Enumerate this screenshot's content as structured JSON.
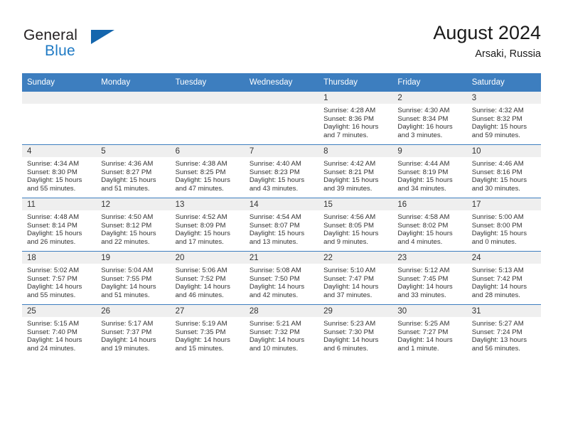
{
  "brand": {
    "name_part1": "General",
    "name_part2": "Blue",
    "logo_icon": "triangle-icon"
  },
  "header": {
    "title": "August 2024",
    "location": "Arsaki, Russia"
  },
  "calendar": {
    "weekday_headers": [
      "Sunday",
      "Monday",
      "Tuesday",
      "Wednesday",
      "Thursday",
      "Friday",
      "Saturday"
    ],
    "labels": {
      "sunrise": "Sunrise:",
      "sunset": "Sunset:",
      "daylight": "Daylight:"
    },
    "accent_color": "#3d7ebf",
    "daynum_bg": "#efefef",
    "weeks": [
      [
        {
          "day": "",
          "empty": true
        },
        {
          "day": "",
          "empty": true
        },
        {
          "day": "",
          "empty": true
        },
        {
          "day": "",
          "empty": true
        },
        {
          "day": "1",
          "sunrise": "Sunrise: 4:28 AM",
          "sunset": "Sunset: 8:36 PM",
          "daylight1": "Daylight: 16 hours",
          "daylight2": "and 7 minutes."
        },
        {
          "day": "2",
          "sunrise": "Sunrise: 4:30 AM",
          "sunset": "Sunset: 8:34 PM",
          "daylight1": "Daylight: 16 hours",
          "daylight2": "and 3 minutes."
        },
        {
          "day": "3",
          "sunrise": "Sunrise: 4:32 AM",
          "sunset": "Sunset: 8:32 PM",
          "daylight1": "Daylight: 15 hours",
          "daylight2": "and 59 minutes."
        }
      ],
      [
        {
          "day": "4",
          "sunrise": "Sunrise: 4:34 AM",
          "sunset": "Sunset: 8:30 PM",
          "daylight1": "Daylight: 15 hours",
          "daylight2": "and 55 minutes."
        },
        {
          "day": "5",
          "sunrise": "Sunrise: 4:36 AM",
          "sunset": "Sunset: 8:27 PM",
          "daylight1": "Daylight: 15 hours",
          "daylight2": "and 51 minutes."
        },
        {
          "day": "6",
          "sunrise": "Sunrise: 4:38 AM",
          "sunset": "Sunset: 8:25 PM",
          "daylight1": "Daylight: 15 hours",
          "daylight2": "and 47 minutes."
        },
        {
          "day": "7",
          "sunrise": "Sunrise: 4:40 AM",
          "sunset": "Sunset: 8:23 PM",
          "daylight1": "Daylight: 15 hours",
          "daylight2": "and 43 minutes."
        },
        {
          "day": "8",
          "sunrise": "Sunrise: 4:42 AM",
          "sunset": "Sunset: 8:21 PM",
          "daylight1": "Daylight: 15 hours",
          "daylight2": "and 39 minutes."
        },
        {
          "day": "9",
          "sunrise": "Sunrise: 4:44 AM",
          "sunset": "Sunset: 8:19 PM",
          "daylight1": "Daylight: 15 hours",
          "daylight2": "and 34 minutes."
        },
        {
          "day": "10",
          "sunrise": "Sunrise: 4:46 AM",
          "sunset": "Sunset: 8:16 PM",
          "daylight1": "Daylight: 15 hours",
          "daylight2": "and 30 minutes."
        }
      ],
      [
        {
          "day": "11",
          "sunrise": "Sunrise: 4:48 AM",
          "sunset": "Sunset: 8:14 PM",
          "daylight1": "Daylight: 15 hours",
          "daylight2": "and 26 minutes."
        },
        {
          "day": "12",
          "sunrise": "Sunrise: 4:50 AM",
          "sunset": "Sunset: 8:12 PM",
          "daylight1": "Daylight: 15 hours",
          "daylight2": "and 22 minutes."
        },
        {
          "day": "13",
          "sunrise": "Sunrise: 4:52 AM",
          "sunset": "Sunset: 8:09 PM",
          "daylight1": "Daylight: 15 hours",
          "daylight2": "and 17 minutes."
        },
        {
          "day": "14",
          "sunrise": "Sunrise: 4:54 AM",
          "sunset": "Sunset: 8:07 PM",
          "daylight1": "Daylight: 15 hours",
          "daylight2": "and 13 minutes."
        },
        {
          "day": "15",
          "sunrise": "Sunrise: 4:56 AM",
          "sunset": "Sunset: 8:05 PM",
          "daylight1": "Daylight: 15 hours",
          "daylight2": "and 9 minutes."
        },
        {
          "day": "16",
          "sunrise": "Sunrise: 4:58 AM",
          "sunset": "Sunset: 8:02 PM",
          "daylight1": "Daylight: 15 hours",
          "daylight2": "and 4 minutes."
        },
        {
          "day": "17",
          "sunrise": "Sunrise: 5:00 AM",
          "sunset": "Sunset: 8:00 PM",
          "daylight1": "Daylight: 15 hours",
          "daylight2": "and 0 minutes."
        }
      ],
      [
        {
          "day": "18",
          "sunrise": "Sunrise: 5:02 AM",
          "sunset": "Sunset: 7:57 PM",
          "daylight1": "Daylight: 14 hours",
          "daylight2": "and 55 minutes."
        },
        {
          "day": "19",
          "sunrise": "Sunrise: 5:04 AM",
          "sunset": "Sunset: 7:55 PM",
          "daylight1": "Daylight: 14 hours",
          "daylight2": "and 51 minutes."
        },
        {
          "day": "20",
          "sunrise": "Sunrise: 5:06 AM",
          "sunset": "Sunset: 7:52 PM",
          "daylight1": "Daylight: 14 hours",
          "daylight2": "and 46 minutes."
        },
        {
          "day": "21",
          "sunrise": "Sunrise: 5:08 AM",
          "sunset": "Sunset: 7:50 PM",
          "daylight1": "Daylight: 14 hours",
          "daylight2": "and 42 minutes."
        },
        {
          "day": "22",
          "sunrise": "Sunrise: 5:10 AM",
          "sunset": "Sunset: 7:47 PM",
          "daylight1": "Daylight: 14 hours",
          "daylight2": "and 37 minutes."
        },
        {
          "day": "23",
          "sunrise": "Sunrise: 5:12 AM",
          "sunset": "Sunset: 7:45 PM",
          "daylight1": "Daylight: 14 hours",
          "daylight2": "and 33 minutes."
        },
        {
          "day": "24",
          "sunrise": "Sunrise: 5:13 AM",
          "sunset": "Sunset: 7:42 PM",
          "daylight1": "Daylight: 14 hours",
          "daylight2": "and 28 minutes."
        }
      ],
      [
        {
          "day": "25",
          "sunrise": "Sunrise: 5:15 AM",
          "sunset": "Sunset: 7:40 PM",
          "daylight1": "Daylight: 14 hours",
          "daylight2": "and 24 minutes."
        },
        {
          "day": "26",
          "sunrise": "Sunrise: 5:17 AM",
          "sunset": "Sunset: 7:37 PM",
          "daylight1": "Daylight: 14 hours",
          "daylight2": "and 19 minutes."
        },
        {
          "day": "27",
          "sunrise": "Sunrise: 5:19 AM",
          "sunset": "Sunset: 7:35 PM",
          "daylight1": "Daylight: 14 hours",
          "daylight2": "and 15 minutes."
        },
        {
          "day": "28",
          "sunrise": "Sunrise: 5:21 AM",
          "sunset": "Sunset: 7:32 PM",
          "daylight1": "Daylight: 14 hours",
          "daylight2": "and 10 minutes."
        },
        {
          "day": "29",
          "sunrise": "Sunrise: 5:23 AM",
          "sunset": "Sunset: 7:30 PM",
          "daylight1": "Daylight: 14 hours",
          "daylight2": "and 6 minutes."
        },
        {
          "day": "30",
          "sunrise": "Sunrise: 5:25 AM",
          "sunset": "Sunset: 7:27 PM",
          "daylight1": "Daylight: 14 hours",
          "daylight2": "and 1 minute."
        },
        {
          "day": "31",
          "sunrise": "Sunrise: 5:27 AM",
          "sunset": "Sunset: 7:24 PM",
          "daylight1": "Daylight: 13 hours",
          "daylight2": "and 56 minutes."
        }
      ]
    ]
  }
}
